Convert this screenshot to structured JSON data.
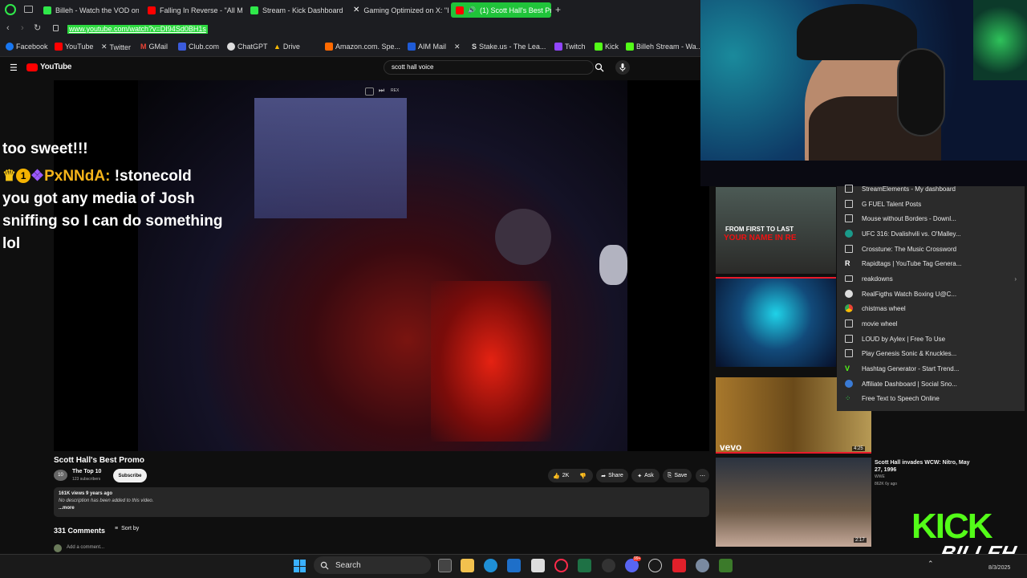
{
  "tabs": [
    {
      "label": "Billeh - Watch the VOD on",
      "color": "#2fe84a"
    },
    {
      "label": "Falling In Reverse - \"All My",
      "color": "#ff0000"
    },
    {
      "label": "Stream - Kick Dashboard",
      "color": "#2fe84a"
    },
    {
      "label": "Gaming Optimized on X: \"I",
      "color": "#000000"
    },
    {
      "label": "(1) Scott Hall's Best Pro",
      "color": "#ff0000"
    }
  ],
  "new_tab_label": "+",
  "url": "www.youtube.com/watch?v=DI94Sd0BH1s",
  "bookmarks": [
    "Facebook",
    "YouTube",
    "Twitter",
    "GMail",
    "Club.com",
    "ChatGPT",
    "Drive",
    "Amazon.com. Spe...",
    "AIM Mail",
    "",
    "Stake.us - The Lea...",
    "Twitch",
    "Kick",
    "Billeh Stream - Wa..."
  ],
  "youtube": {
    "logo_text": "YouTube",
    "search_value": "scott hall voice"
  },
  "video": {
    "title": "Scott Hall's Best Promo",
    "channel": "The Top 10",
    "channel_avatar": "10",
    "subscribers": "123 subscribers",
    "subscribe_label": "Subscribe",
    "like_count": "2K",
    "share_label": "Share",
    "ask_label": "Ask",
    "save_label": "Save",
    "views_age": "161K views  9 years ago",
    "description": "No description has been added to this video.",
    "more_label": "...more",
    "player_badge": "REX"
  },
  "comments": {
    "count_label": "331 Comments",
    "sort_label": "Sort by",
    "add_placeholder": "Add a comment..."
  },
  "chat": {
    "line0": "too sweet!!!",
    "username": "PxNNdA:",
    "message_start": " !stonecold",
    "message_rest": "you got any media of Josh sniffing so I can do something lol",
    "badge_number": "1"
  },
  "bookmark_menu": [
    {
      "label": "StreamElements - My dashboard",
      "icon": "page-icon"
    },
    {
      "label": "G FUEL Talent Posts",
      "icon": "page-icon"
    },
    {
      "label": "Mouse without Borders - Downl...",
      "icon": "page-icon"
    },
    {
      "label": "UFC 316: Dvalishvili vs. O'Malley...",
      "icon": "globe-icon"
    },
    {
      "label": "Crosstune: The Music Crossword",
      "icon": "page-icon"
    },
    {
      "label": "Rapidtags | YouTube Tag Genera...",
      "icon": "rapidtags-icon"
    },
    {
      "label": "reakdowns",
      "icon": "folder-icon"
    },
    {
      "label": "RealFigths Watch Boxing U@C...",
      "icon": "wordpress-icon"
    },
    {
      "label": "chistmas wheel",
      "icon": "chrome-icon"
    },
    {
      "label": "movie wheel",
      "icon": "page-icon"
    },
    {
      "label": "LOUD by Aylex | Free To Use",
      "icon": "page-icon"
    },
    {
      "label": "Play Genesis Sonic & Knuckles...",
      "icon": "page-icon"
    },
    {
      "label": "Hashtag Generator - Start Trend...",
      "icon": "v-icon"
    },
    {
      "label": "Affiliate Dashboard | Social Sno...",
      "icon": "globe-icon"
    },
    {
      "label": "Free Text to Speech Online",
      "icon": "speech-icon"
    }
  ],
  "recommended": [
    {
      "title_overlay_1": "FROM FIRST TO LAST",
      "title_overlay_2": "YOUR NAME IN RE"
    },
    {
      "vevo": "vevo",
      "duration": "4:25"
    },
    {
      "title": "Scott Hall invades WCW: Nitro, May 27, 1996",
      "channel": "WWE",
      "meta": "862K  6y ago",
      "duration": "2:17"
    }
  ],
  "overlay": {
    "kick_logo": "KICK",
    "signature": "BILLEH"
  },
  "taskbar": {
    "search_label": "Search",
    "date": "8/3/2025",
    "discord_badge": "99+"
  },
  "colors": {
    "kick_green": "#53fc18",
    "youtube_red": "#ff0000",
    "active_tab": "#20c33a"
  }
}
